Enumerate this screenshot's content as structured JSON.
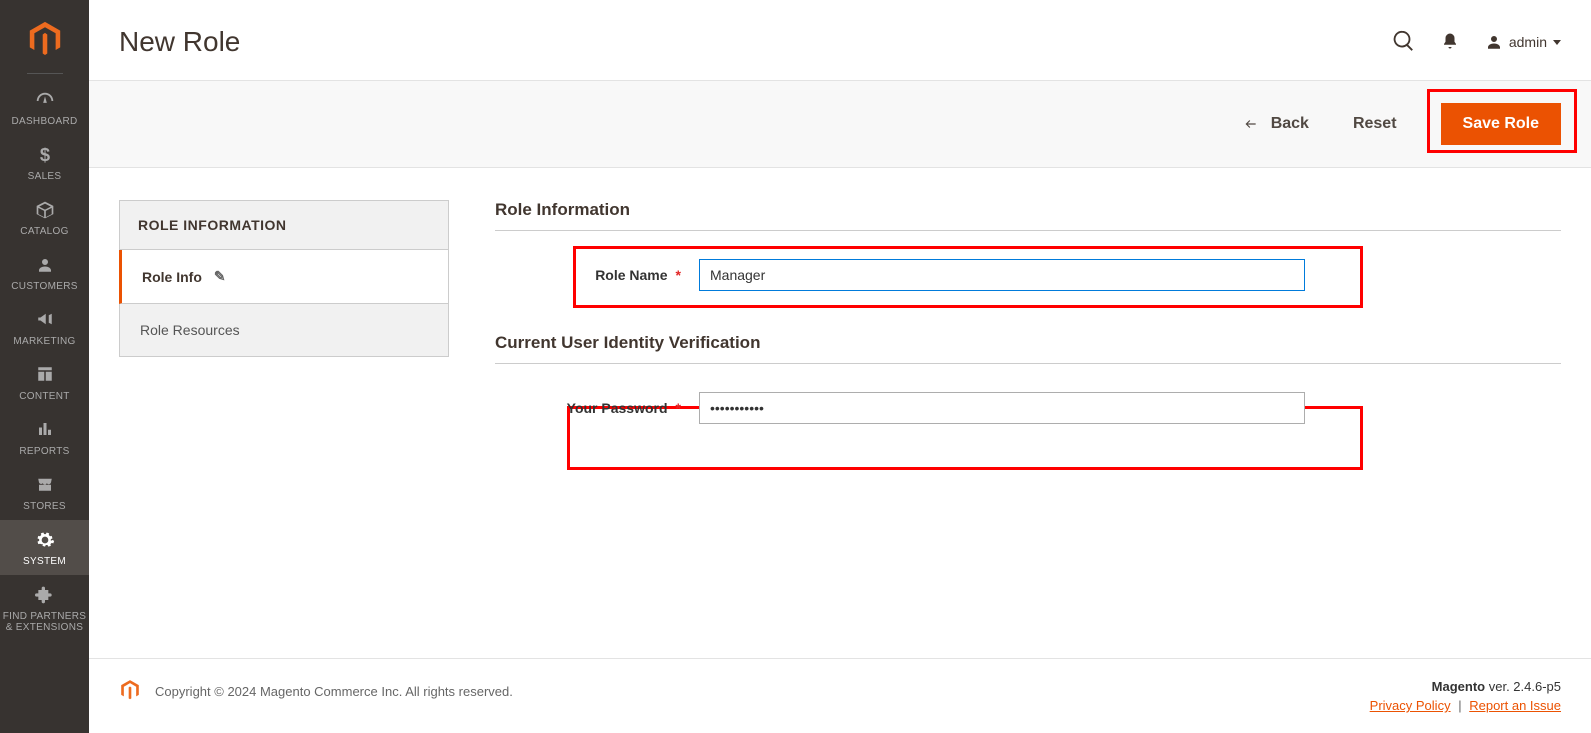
{
  "sidebar": {
    "items": [
      {
        "label": "DASHBOARD"
      },
      {
        "label": "SALES"
      },
      {
        "label": "CATALOG"
      },
      {
        "label": "CUSTOMERS"
      },
      {
        "label": "MARKETING"
      },
      {
        "label": "CONTENT"
      },
      {
        "label": "REPORTS"
      },
      {
        "label": "STORES"
      },
      {
        "label": "SYSTEM"
      },
      {
        "label": "FIND PARTNERS & EXTENSIONS"
      }
    ]
  },
  "header": {
    "title": "New Role",
    "user": "admin"
  },
  "actions": {
    "back": "Back",
    "reset": "Reset",
    "save": "Save Role"
  },
  "tabs": {
    "heading": "ROLE INFORMATION",
    "items": [
      {
        "label": "Role Info"
      },
      {
        "label": "Role Resources"
      }
    ]
  },
  "form": {
    "section1": {
      "legend": "Role Information",
      "role_name_label": "Role Name",
      "role_name_value": "Manager"
    },
    "section2": {
      "legend": "Current User Identity Verification",
      "password_label": "Your Password",
      "password_value": "•••••••••••"
    }
  },
  "footer": {
    "copyright": "Copyright © 2024 Magento Commerce Inc. All rights reserved.",
    "version_prefix": "Magento",
    "version": " ver. 2.4.6-p5",
    "privacy": "Privacy Policy",
    "report": "Report an Issue"
  }
}
